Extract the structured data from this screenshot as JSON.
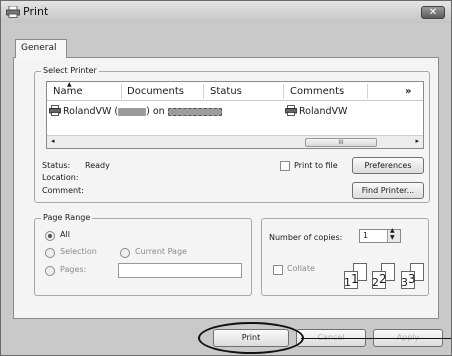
{
  "window": {
    "title": "Print",
    "close_icon": "close-icon",
    "title_icon": "printer-icon"
  },
  "tabs": [
    {
      "label": "General",
      "selected": true
    }
  ],
  "select_printer": {
    "legend": "Select Printer",
    "columns": [
      "Name",
      "Documents",
      "Status",
      "Comments",
      "»"
    ],
    "rows": [
      {
        "name": "RolandVW (",
        "name_tail": ") on ",
        "comment": "RolandVW"
      }
    ],
    "scroll_thumb": "III"
  },
  "printer_info": {
    "status_label": "Status:",
    "status_value": "Ready",
    "location_label": "Location:",
    "comment_label": "Comment:",
    "print_to_file_label": "Print to file",
    "preferences_label": "Preferences",
    "find_printer_label": "Find Printer..."
  },
  "page_range": {
    "legend": "Page Range",
    "all_label": "All",
    "selection_label": "Selection",
    "current_page_label": "Current Page",
    "pages_label": "Pages:",
    "selected": "All"
  },
  "copies": {
    "number_label": "Number of copies:",
    "value": "1",
    "collate_label": "Collate",
    "collate_pages": [
      "1",
      "1",
      "2",
      "2",
      "3",
      "3"
    ]
  },
  "buttons": {
    "print": "Print",
    "cancel": "Cancel",
    "apply": "Apply"
  }
}
